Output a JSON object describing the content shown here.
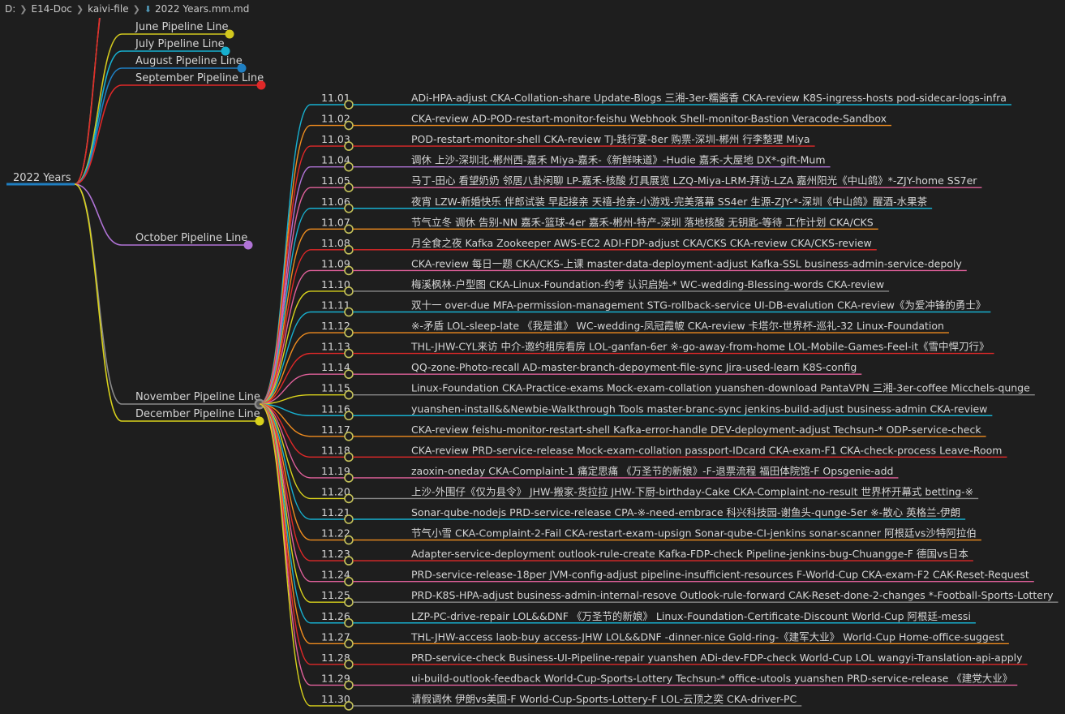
{
  "breadcrumb": [
    "D:",
    "E14-Doc",
    "kaivi-file",
    "2022 Years.mm.md"
  ],
  "colors": {
    "bg": "#1e1e1e",
    "text": "#d4d4d4"
  },
  "root": "2022 Years",
  "branches": [
    {
      "label": "June Pipeline Line",
      "color": "#d2c81e"
    },
    {
      "label": "July Pipeline Line",
      "color": "#17b0d0"
    },
    {
      "label": "August Pipeline Line",
      "color": "#1f7fc2"
    },
    {
      "label": "September Pipeline Line",
      "color": "#e02828"
    },
    {
      "label": "October Pipeline Line",
      "color": "#b073d6"
    },
    {
      "label": "November Pipeline Line",
      "color": "#8a8a8a"
    },
    {
      "label": "December Pipeline Line",
      "color": "#d9d21c"
    }
  ],
  "days": [
    {
      "date": "11.01",
      "text": "ADi-HPA-adjust CKA-Collation-share Update-Blogs 三湘-3er-糯酱香 CKA-review K8S-ingress-hosts pod-sidecar-logs-infra",
      "color": "#17b0d0"
    },
    {
      "date": "11.02",
      "text": "CKA-review AD-POD-restart-monitor-feishu Webhook Shell-monitor-Bastion Veracode-Sandbox",
      "color": "#f08c1e"
    },
    {
      "date": "11.03",
      "text": "POD-restart-monitor-shell CKA-review TJ-践行宴-8er 购票-深圳-郴州 行李整理 Miya",
      "color": "#e02828"
    },
    {
      "date": "11.04",
      "text": "调休 上沙-深圳北-郴州西-嘉禾 Miya-嘉禾-《新鲜味道》-Hudie 嘉禾-大屋地 DX*-gift-Mum",
      "color": "#b073d6"
    },
    {
      "date": "11.05",
      "text": "马丁-田心 看望奶奶 邻居八卦闲聊 LP-嘉禾-核酸 灯具展览 LZQ-Miya-LRM-拜访-LZA 嘉州阳光《中山鸽》*-ZJY-home SS7er",
      "color": "#e0609a"
    },
    {
      "date": "11.06",
      "text": "夜宵 LZW-新婚快乐 伴郎试装 早起接亲 天禧-抢亲-小游戏-完美落幕 SS4er 生源-ZJY-*-深圳《中山鸽》醒酒-水果茶",
      "color": "#17b0d0"
    },
    {
      "date": "11.07",
      "text": "节气立冬 调休 告别-NN 嘉禾-篮球-4er 嘉禾-郴州-特产-深圳 落地核酸 无钥匙-等待 工作计划 CKA/CKS",
      "color": "#f08c1e"
    },
    {
      "date": "11.08",
      "text": "月全食之夜 Kafka Zookeeper AWS-EC2 ADI-FDP-adjust CKA/CKS CKA-review CKA/CKS-review",
      "color": "#e02828"
    },
    {
      "date": "11.09",
      "text": "CKA-review 每日一题 CKA/CKS-上课 master-data-deployment-adjust Kafka-SSL business-admin-service-depoly",
      "color": "#e0609a"
    },
    {
      "date": "11.10",
      "text": "梅溪枫林-户型图 CKA-Linux-Foundation-约考 认识启始-* WC-wedding-Blessing-words CKA-review",
      "color": "#8a8a8a"
    },
    {
      "date": "11.11",
      "text": "双十一 over-due MFA-permission-management STG-rollback-service UI-DB-evalution CKA-review《为爱冲锋的勇士》",
      "color": "#17b0d0"
    },
    {
      "date": "11.12",
      "text": "※-矛盾 LOL-sleep-late 《我是谁》 WC-wedding-凤冠霞帔 CKA-review 卡塔尔-世界杯-巡礼-32 Linux-Foundation",
      "color": "#f08c1e"
    },
    {
      "date": "11.13",
      "text": "THL-JHW-CYL来访 中介-邀约租房看房 LOL-ganfan-6er ※-go-away-from-home LOL-Mobile-Games-Feel-it《雪中悍刀行》",
      "color": "#e02828"
    },
    {
      "date": "11.14",
      "text": "QQ-zone-Photo-recall AD-master-branch-depoyment-file-sync Jira-used-learn K8S-config",
      "color": "#e0609a"
    },
    {
      "date": "11.15",
      "text": "Linux-Foundation CKA-Practice-exams Mock-exam-collation yuanshen-download PantaVPN 三湘-3er-coffee Micchels-qunge",
      "color": "#8a8a8a"
    },
    {
      "date": "11.16",
      "text": "yuanshen-install&&Newbie-Walkthrough Tools master-branc-sync jenkins-build-adjust business-admin CKA-review",
      "color": "#17b0d0"
    },
    {
      "date": "11.17",
      "text": "CKA-review feishu-monitor-restart-shell Kafka-error-handle DEV-deployment-adjust Techsun-* ODP-service-check",
      "color": "#f08c1e"
    },
    {
      "date": "11.18",
      "text": "CKA-review PRD-service-release Mock-exam-collation passport-IDcard CKA-exam-F1 CKA-check-process Leave-Room",
      "color": "#e02828"
    },
    {
      "date": "11.19",
      "text": "zaoxin-oneday CKA-Complaint-1 痛定思痛 《万圣节的新娘》-F-退票流程 福田体院馆-F Opsgenie-add",
      "color": "#e0609a"
    },
    {
      "date": "11.20",
      "text": "上沙-外围仔《仅为县令》 JHW-搬家-货拉拉 JHW-下厨-birthday-Cake CKA-Complaint-no-result 世界杯开幕式 betting-※",
      "color": "#8a8a8a"
    },
    {
      "date": "11.21",
      "text": "Sonar-qube-nodejs PRD-service-release CPA-※-need-embrace 科兴科技园-谢鱼头-qunge-5er ※-散心 英格兰-伊朗",
      "color": "#17b0d0"
    },
    {
      "date": "11.22",
      "text": "节气小雪 CKA-Complaint-2-Fail CKA-restart-exam-upsign Sonar-qube-CI-jenkins sonar-scanner 阿根廷vs沙特阿拉伯",
      "color": "#f08c1e"
    },
    {
      "date": "11.23",
      "text": "Adapter-service-deployment outlook-rule-create Kafka-FDP-check Pipeline-jenkins-bug-Chuangge-F 德国vs日本",
      "color": "#e02828"
    },
    {
      "date": "11.24",
      "text": "PRD-service-release-18per JVM-config-adjust pipeline-insufficient-resources F-World-Cup CKA-exam-F2 CAK-Reset-Request",
      "color": "#e0609a"
    },
    {
      "date": "11.25",
      "text": "PRD-K8S-HPA-adjust business-admin-internal-resove Outlook-rule-forward CAK-Reset-done-2-changes *-Football-Sports-Lottery",
      "color": "#8a8a8a"
    },
    {
      "date": "11.26",
      "text": "LZP-PC-drive-repair LOL&&DNF 《万圣节的新娘》 Linux-Foundation-Certificate-Discount World-Cup 阿根廷-messi",
      "color": "#17b0d0"
    },
    {
      "date": "11.27",
      "text": "THL-JHW-access laob-buy access-JHW LOL&&DNF -dinner-nice Gold-ring-《建军大业》 World-Cup Home-office-suggest",
      "color": "#f08c1e"
    },
    {
      "date": "11.28",
      "text": "PRD-service-check Business-UI-Pipeline-repair yuanshen ADi-dev-FDP-check World-Cup LOL wangyi-Translation-api-apply",
      "color": "#e02828"
    },
    {
      "date": "11.29",
      "text": "ui-build-outlook-feedback World-Cup-Sports-Lottery Techsun-* office-utools yuanshen PRD-service-release 《建党大业》",
      "color": "#e0609a"
    },
    {
      "date": "11.30",
      "text": "请假调休 伊朗vs美国-F World-Cup-Sports-Lottery-F LOL-云顶之奕 CKA-driver-PC",
      "color": "#8a8a8a"
    }
  ]
}
